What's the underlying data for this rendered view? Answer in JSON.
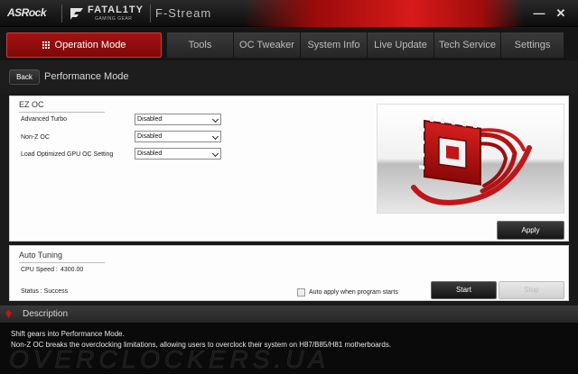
{
  "titlebar": {
    "logo": "ASRock",
    "fatality_brand": "FATAL1TY",
    "fatality_sub": "GAMING GEAR",
    "app_name": "F-Stream",
    "minimize_label": "—",
    "close_label": "✕"
  },
  "nav": {
    "active_tab": "Operation Mode",
    "tabs": [
      "Tools",
      "OC Tweaker",
      "System Info",
      "Live Update",
      "Tech Service",
      "Settings"
    ]
  },
  "header": {
    "back_label": "Back",
    "title": "Performance Mode"
  },
  "ez_oc": {
    "title": "EZ OC",
    "rows": [
      {
        "label": "Advanced Turbo",
        "value": "Disabled"
      },
      {
        "label": "Non-Z OC",
        "value": "Disabled"
      },
      {
        "label": "Load Optimized GPU OC Setting",
        "value": "Disabled"
      }
    ],
    "apply_label": "Apply"
  },
  "auto_tuning": {
    "title": "Auto Tuning",
    "cpu_speed_label": "CPU Speed :",
    "cpu_speed_value": "4300.00",
    "status": "Status : Success",
    "auto_apply_label": "Auto apply when program starts",
    "auto_apply_checked": false,
    "start_label": "Start",
    "stop_label": "Stop"
  },
  "description": {
    "title": "Description",
    "lines": [
      "Shift gears into Performance Mode.",
      "Non-Z OC breaks the overclocking limitations, allowing users to overclock their system on H87/B85/H81 motherboards."
    ],
    "watermark": "OVERCLOCKERS.UA"
  },
  "colors": {
    "accent_red": "#a41212",
    "panel_bg": "#fdfdfd",
    "app_bg": "#1a1a1a"
  }
}
